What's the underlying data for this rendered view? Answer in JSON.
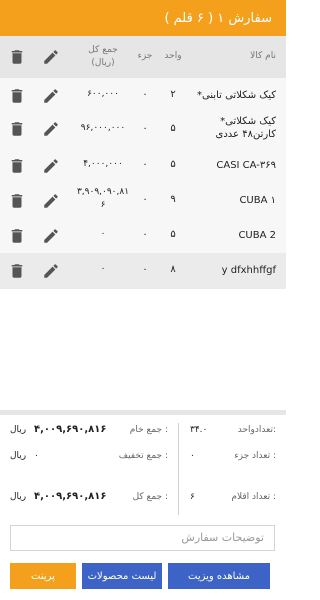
{
  "header": {
    "title": "سفارش ۱ ( ۶ قلم )"
  },
  "columns": {
    "name": "نام کالا",
    "unit": "واحد",
    "part": "جزء",
    "total": "جمع کل\n(ریال)"
  },
  "rows": [
    {
      "name": "*کیک شکلاتی تابنی",
      "unit": "۲",
      "part": "۰",
      "total": "۶۰۰,۰۰۰"
    },
    {
      "name": "*کیک شکلاتی\nکارتن۴۸ عددی",
      "unit": "۵",
      "part": "۰",
      "total": "۹۶,۰۰۰,۰۰۰"
    },
    {
      "name": "CASI CA-۳۶۹",
      "unit": "۵",
      "part": "۰",
      "total": "۴,۰۰۰,۰۰۰"
    },
    {
      "name": "CUBA ۱",
      "unit": "۹",
      "part": "۰",
      "total": "۳,۹۰۹,۰۹۰,۸۱\n۶"
    },
    {
      "name": "CUBA 2",
      "unit": "۵",
      "part": "۰",
      "total": "۰"
    },
    {
      "name": "y dfxhhffgf",
      "unit": "۸",
      "part": "۰",
      "total": "۰"
    }
  ],
  "summary": {
    "units_label": "تعدادواحد:",
    "units_value": "۳۴.۰",
    "parts_label": "تعداد جزء :",
    "parts_value": "۰",
    "items_label": "تعداد اقلام :",
    "items_value": "۶",
    "gross_label": "جمع خام :",
    "gross_value": "۴,۰۰۹,۶۹۰,۸۱۶",
    "gross_currency": "ریال",
    "discount_label": "جمع تخفیف :",
    "discount_value": "۰",
    "discount_currency": "ریال",
    "net_label": "جمع کل :",
    "net_value": "۴,۰۰۹,۶۹۰,۸۱۶",
    "net_currency": "ریال"
  },
  "note": {
    "placeholder": "توضیحات سفارش"
  },
  "buttons": {
    "view_visit": "مشاهده ویزیت",
    "product_list": "لیست محصولات",
    "print": "پرینت"
  },
  "colors": {
    "accent": "#f5a01c",
    "blue": "#3d63c7",
    "header_bg": "#e6e6e6",
    "icon": "#555555"
  }
}
